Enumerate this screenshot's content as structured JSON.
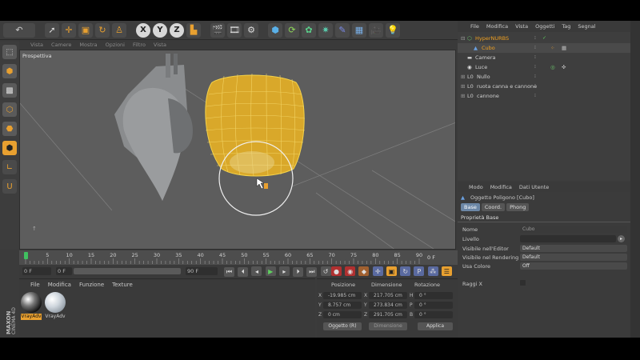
{
  "toolbar": {
    "axes": [
      "X",
      "Y",
      "Z"
    ]
  },
  "viewport": {
    "menu": [
      "Vista",
      "Camere",
      "Mostra",
      "Opzioni",
      "Filtro",
      "Vista"
    ],
    "label": "Prospettiva"
  },
  "timeline": {
    "ticks": [
      "0",
      "5",
      "10",
      "15",
      "20",
      "25",
      "30",
      "35",
      "40",
      "45",
      "50",
      "55",
      "60",
      "65",
      "70",
      "75",
      "80",
      "85",
      "90"
    ],
    "end_frame": "0 F",
    "current_frame": "0 F",
    "start_field": "0 F",
    "end_field": "90 F"
  },
  "materials": {
    "menu": [
      "File",
      "Modifica",
      "Funzione",
      "Texture"
    ],
    "items": [
      {
        "label": "VrayAdv"
      },
      {
        "label": "VrayAdv"
      }
    ]
  },
  "coordinates": {
    "headers": [
      "Posizione",
      "Dimensione",
      "Rotazione"
    ],
    "position": {
      "x": "-19.985 cm",
      "y": "8.757 cm",
      "z": "0 cm"
    },
    "size": {
      "x": "217.705 cm",
      "y": "273.834 cm",
      "z": "291.705 cm"
    },
    "rotation": {
      "h": "0 °",
      "p": "0 °",
      "b": "0 °"
    },
    "mode_select": "Oggetto (R)",
    "size_btn": "Dimensione",
    "apply_btn": "Applica"
  },
  "object_manager": {
    "menu": [
      "File",
      "Modifica",
      "Vista",
      "Oggetti",
      "Tag",
      "Segnal"
    ],
    "objects": [
      {
        "name": "HyperNURBS",
        "selected": true
      },
      {
        "name": "Cubo",
        "selected": true
      },
      {
        "name": "Camera",
        "selected": false
      },
      {
        "name": "Luce",
        "selected": false
      },
      {
        "name": "Nullo",
        "selected": false
      },
      {
        "name": "ruota canna e cannone",
        "selected": false
      },
      {
        "name": "cannone",
        "selected": false
      }
    ]
  },
  "attributes": {
    "menu": [
      "Modo",
      "Modifica",
      "Dati Utente"
    ],
    "title": "Oggetto Poligono [Cubo]",
    "tabs": [
      "Base",
      "Coord.",
      "Phong"
    ],
    "section": "Proprietà Base",
    "fields": [
      {
        "label": "Nome",
        "value": "Cubo"
      },
      {
        "label": "Livello",
        "value": ""
      },
      {
        "label": "Visibile nell'Editor",
        "value": "Default"
      },
      {
        "label": "Visibile nel Rendering",
        "value": "Default"
      },
      {
        "label": "Usa Colore",
        "value": "Off"
      },
      {
        "label": "Raggi X",
        "value": ""
      }
    ]
  },
  "colors": {
    "accent": "#e8a030",
    "viewport_bg": "#5d5d5d",
    "panel_bg": "#3b3b3b"
  },
  "brand": "MAXON CINEMA 4D"
}
